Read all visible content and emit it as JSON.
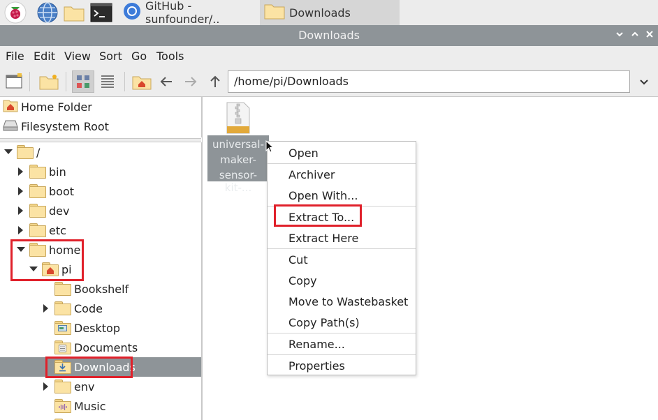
{
  "taskbar": {
    "buttons": [
      {
        "label": "GitHub - sunfounder/.."
      },
      {
        "label": "Downloads"
      }
    ]
  },
  "window": {
    "title": "Downloads"
  },
  "menubar": [
    "File",
    "Edit",
    "View",
    "Sort",
    "Go",
    "Tools"
  ],
  "location": {
    "path": "/home/pi/Downloads"
  },
  "places": [
    {
      "label": "Home Folder",
      "icon": "home-icon"
    },
    {
      "label": "Filesystem Root",
      "icon": "drive-icon"
    }
  ],
  "tree": [
    {
      "label": "/",
      "expander": "expanded"
    },
    {
      "label": "bin",
      "expander": "collapsed"
    },
    {
      "label": "boot",
      "expander": "collapsed"
    },
    {
      "label": "dev",
      "expander": "collapsed"
    },
    {
      "label": "etc",
      "expander": "collapsed"
    },
    {
      "label": "home",
      "expander": "expanded"
    },
    {
      "label": "pi",
      "expander": "expanded"
    },
    {
      "label": "Bookshelf",
      "expander": "none"
    },
    {
      "label": "Code",
      "expander": "collapsed"
    },
    {
      "label": "Desktop",
      "expander": "none"
    },
    {
      "label": "Documents",
      "expander": "none"
    },
    {
      "label": "Downloads",
      "expander": "none",
      "selected": true
    },
    {
      "label": "env",
      "expander": "collapsed"
    },
    {
      "label": "Music",
      "expander": "none"
    }
  ],
  "files": [
    {
      "name_lines": [
        "universal-",
        "maker-",
        "sensor-kit-..."
      ],
      "icon": "zip-archive-icon",
      "selected": true
    }
  ],
  "context_menu": {
    "items": [
      "Open",
      "Archiver",
      "Open With...",
      "Extract To...",
      "Extract Here",
      "Cut",
      "Copy",
      "Move to Wastebasket",
      "Copy Path(s)",
      "Rename...",
      "Properties"
    ]
  },
  "colors": {
    "selection": "#8e9498",
    "titlebar": "#8e9498",
    "highlight_box": "#e0202a",
    "folder": "#fbe3a4"
  }
}
